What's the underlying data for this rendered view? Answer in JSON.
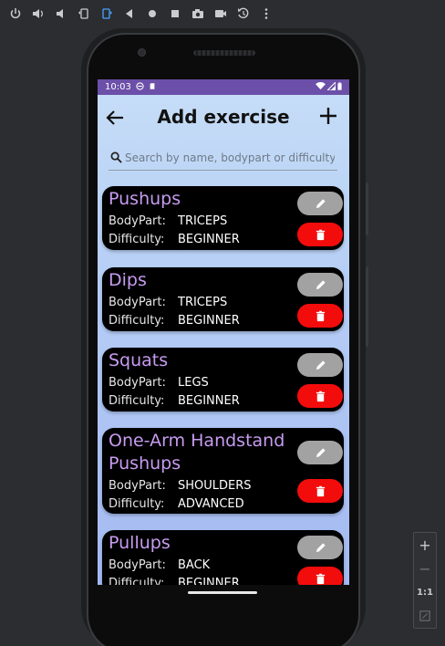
{
  "toolbar": {
    "icons": [
      "power-icon",
      "volume-up-icon",
      "volume-down-icon",
      "rotate-left-icon",
      "rotate-right-icon",
      "back-icon",
      "home-icon",
      "overview-icon",
      "camera-icon",
      "record-icon",
      "undo-icon",
      "more-icon"
    ]
  },
  "zoom": {
    "zoom_in": "+",
    "zoom_out": "−",
    "actual_size": "1:1"
  },
  "status": {
    "time": "10:03"
  },
  "appbar": {
    "title": "Add exercise"
  },
  "search": {
    "placeholder": "Search by name, bodypart or difficulty..."
  },
  "labels": {
    "bodypart": "BodyPart:",
    "difficulty": "Difficulty:"
  },
  "exercises": [
    {
      "name": "Pushups",
      "bodypart": "TRICEPS",
      "difficulty": "BEGINNER"
    },
    {
      "name": "Dips",
      "bodypart": "TRICEPS",
      "difficulty": "BEGINNER"
    },
    {
      "name": "Squats",
      "bodypart": "LEGS",
      "difficulty": "BEGINNER"
    },
    {
      "name": "One-Arm Handstand Pushups",
      "name_line1": "One-Arm Handstand",
      "name_line2": "Pushups",
      "bodypart": "SHOULDERS",
      "difficulty": "ADVANCED"
    },
    {
      "name": "Pullups",
      "bodypart": "BACK",
      "difficulty": "BEGINNER"
    }
  ],
  "colors": {
    "accent_purple": "#6b4fa8",
    "name_text": "#c79bf0",
    "delete_red": "#f30c0c",
    "edit_gray": "#a2a2a2"
  }
}
